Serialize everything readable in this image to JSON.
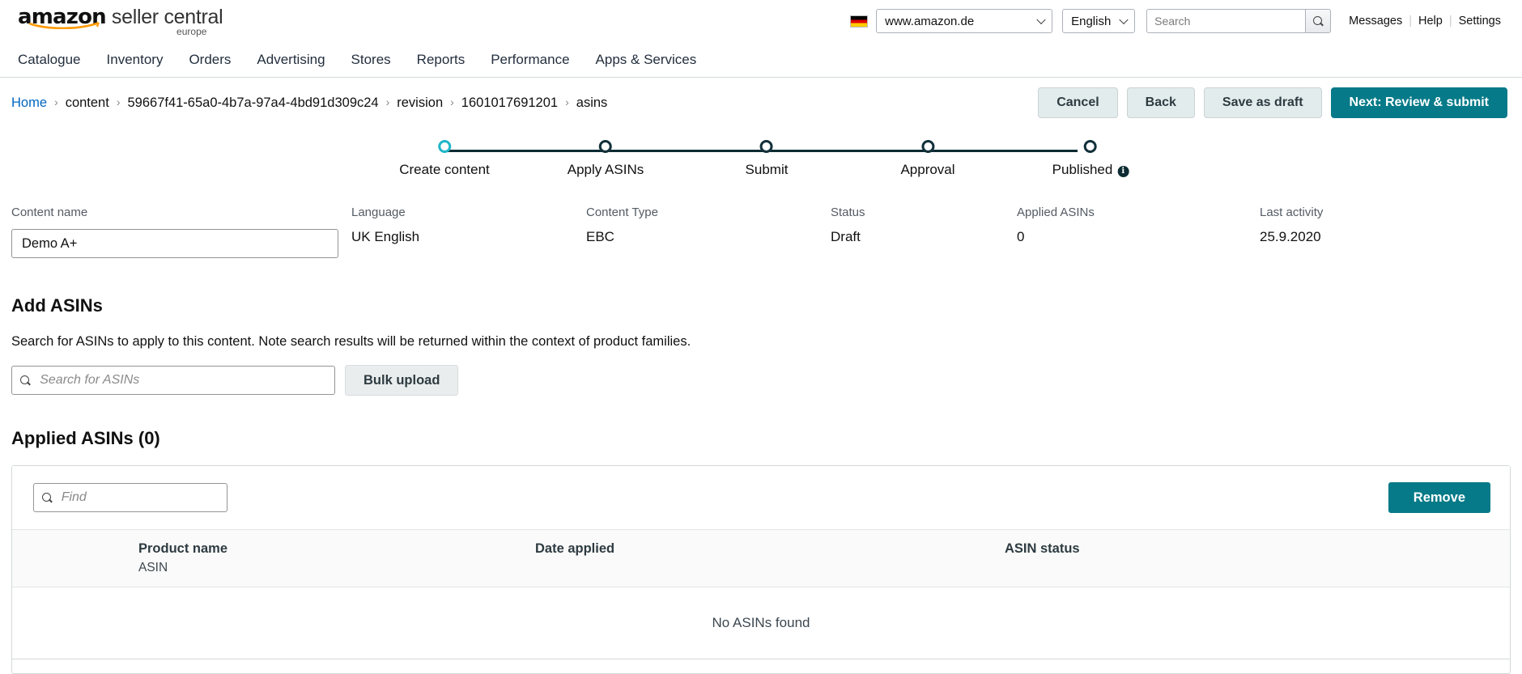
{
  "header": {
    "logo": {
      "amazon": "amazon",
      "seller_central": "seller central",
      "europe": "europe"
    },
    "flag_icon": "german-flag-icon",
    "marketplace_selected": "www.amazon.de",
    "language_selected": "English",
    "search_placeholder": "Search",
    "search_value": "",
    "search_icon": "search-icon",
    "links": [
      {
        "label": "Messages"
      },
      {
        "label": "Help"
      },
      {
        "label": "Settings"
      }
    ],
    "link_divider": "|"
  },
  "nav": {
    "items": [
      {
        "label": "Catalogue"
      },
      {
        "label": "Inventory"
      },
      {
        "label": "Orders"
      },
      {
        "label": "Advertising"
      },
      {
        "label": "Stores"
      },
      {
        "label": "Reports"
      },
      {
        "label": "Performance"
      },
      {
        "label": "Apps & Services"
      }
    ]
  },
  "breadcrumb": {
    "separator": "›",
    "items": [
      {
        "label": "Home",
        "link": true
      },
      {
        "label": "content",
        "link": false
      },
      {
        "label": "59667f41-65a0-4b7a-97a4-4bd91d309c24",
        "link": false
      },
      {
        "label": "revision",
        "link": false
      },
      {
        "label": "1601017691201",
        "link": false
      },
      {
        "label": "asins",
        "link": false
      }
    ]
  },
  "actions": {
    "cancel": "Cancel",
    "back": "Back",
    "save_draft": "Save as draft",
    "next": "Next: Review & submit"
  },
  "stepper": {
    "active_index": 0,
    "info_icon": "info-icon",
    "info_glyph": "i",
    "steps": [
      {
        "label": "Create content"
      },
      {
        "label": "Apply ASINs"
      },
      {
        "label": "Submit"
      },
      {
        "label": "Approval"
      },
      {
        "label": "Published"
      }
    ]
  },
  "meta": {
    "content_name_label": "Content name",
    "content_name_value": "Demo A+",
    "content_name_placeholder": "",
    "language_label": "Language",
    "language_value": "UK English",
    "content_type_label": "Content Type",
    "content_type_value": "EBC",
    "status_label": "Status",
    "status_value": "Draft",
    "applied_asins_label": "Applied ASINs",
    "applied_asins_value": "0",
    "last_activity_label": "Last activity",
    "last_activity_value": "25.9.2020"
  },
  "add_asins": {
    "title": "Add ASINs",
    "description": "Search for ASINs to apply to this content. Note search results will be returned within the context of product families.",
    "search_placeholder": "Search for ASINs",
    "search_value": "",
    "search_icon": "search-icon",
    "bulk_upload": "Bulk upload"
  },
  "applied_asins": {
    "title": "Applied ASINs (0)",
    "find_placeholder": "Find",
    "find_value": "",
    "find_icon": "search-icon",
    "remove_button": "Remove",
    "columns": [
      {
        "header": "Product name",
        "sub": "ASIN"
      },
      {
        "header": "Date applied",
        "sub": ""
      },
      {
        "header": "ASIN status",
        "sub": ""
      }
    ],
    "rows": [],
    "empty_message": "No ASINs found"
  },
  "colors": {
    "accent_teal": "#067a88",
    "step_active": "#1fb6c8",
    "step_dark": "#12303a",
    "link_blue": "#0066c0",
    "button_grey": "#e3eced"
  }
}
